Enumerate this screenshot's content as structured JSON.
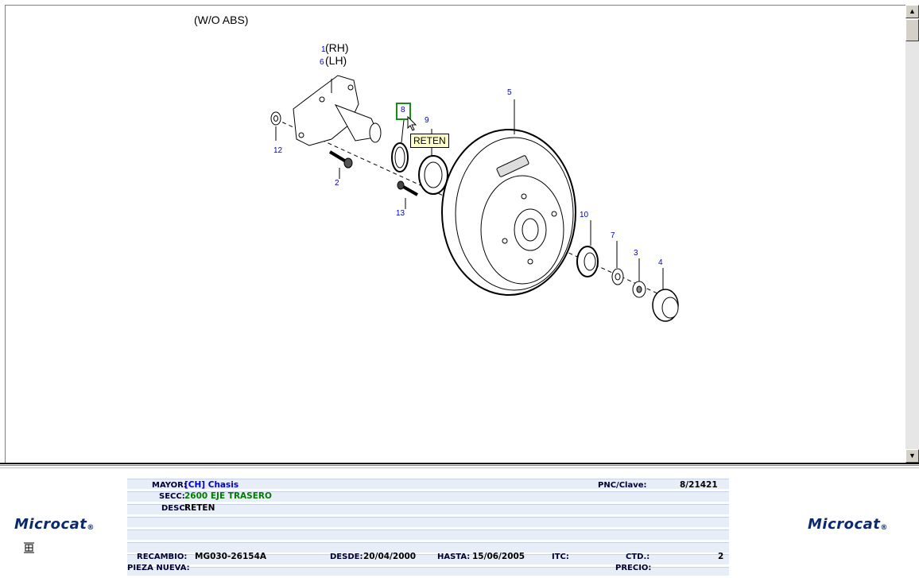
{
  "diagram": {
    "title": "(W/O ABS)",
    "side_labels": {
      "rh": "(RH)",
      "lh": "(LH)",
      "rh_num": "1",
      "lh_num": "6"
    },
    "callouts": [
      "2",
      "3",
      "4",
      "5",
      "7",
      "8",
      "9",
      "10",
      "12",
      "13"
    ],
    "tooltip": "RETEN"
  },
  "info": {
    "mayor_label": "MAYOR:",
    "mayor_value": "[CH]  Chasis",
    "secc_label": "SECC:",
    "secc_value": "2600  EJE TRASERO",
    "desc_label": "DESC:",
    "desc_value": "RETEN",
    "pnc_label": "PNC/Clave:",
    "pnc_value": "8/21421",
    "recambio_label": "RECAMBIO:",
    "recambio_value": "MG030-26154A",
    "desde_label": "DESDE:",
    "desde_value": "20/04/2000",
    "hasta_label": "HASTA:",
    "hasta_value": "15/06/2005",
    "itc_label": "ITC:",
    "ctd_label": "CTD.:",
    "ctd_value": "2",
    "pieza_label": "PIEZA NUEVA:",
    "precio_label": "PRECIO:"
  },
  "branding": {
    "logo_text": "Microcat",
    "reg": "®"
  },
  "colors": {
    "accent_blue": "#0000cc",
    "secc_green": "#007a00",
    "band": "#e8eef7"
  }
}
